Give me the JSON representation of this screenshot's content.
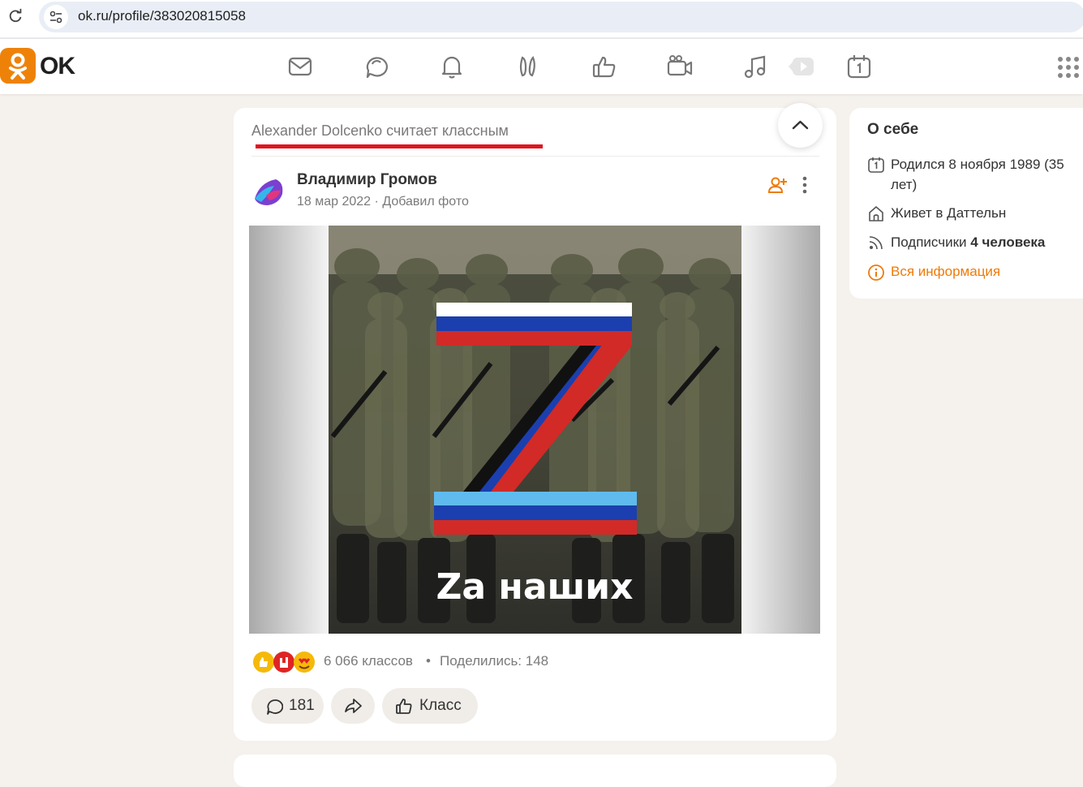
{
  "browser": {
    "url": "ok.ru/profile/383020815058"
  },
  "header": {
    "logo_text": "OK",
    "brand_color": "#ee8208",
    "nav_icons": [
      "messages-icon",
      "discussions-icon",
      "notifications-icon",
      "guests-icon",
      "likes-icon",
      "video-calls-icon",
      "music-icon",
      "video-icon",
      "events-icon"
    ]
  },
  "feed": {
    "liked_by": "Alexander Dolcenko считает классным",
    "post": {
      "author": "Владимир Громов",
      "date": "18 мар 2022",
      "action": "Добавил фото",
      "image_caption": "Zа наших",
      "reactions_count": "6 066 классов",
      "shared": "Поделились: 148",
      "comments_count": "181",
      "like_label": "Класс"
    }
  },
  "about": {
    "title": "О себе",
    "born": "Родился 8 ноября 1989 (35 лет)",
    "lives": "Живет в Даттельн",
    "followers_label": "Подписчики",
    "followers_count": "4 человека",
    "all_info": "Вся информация"
  }
}
